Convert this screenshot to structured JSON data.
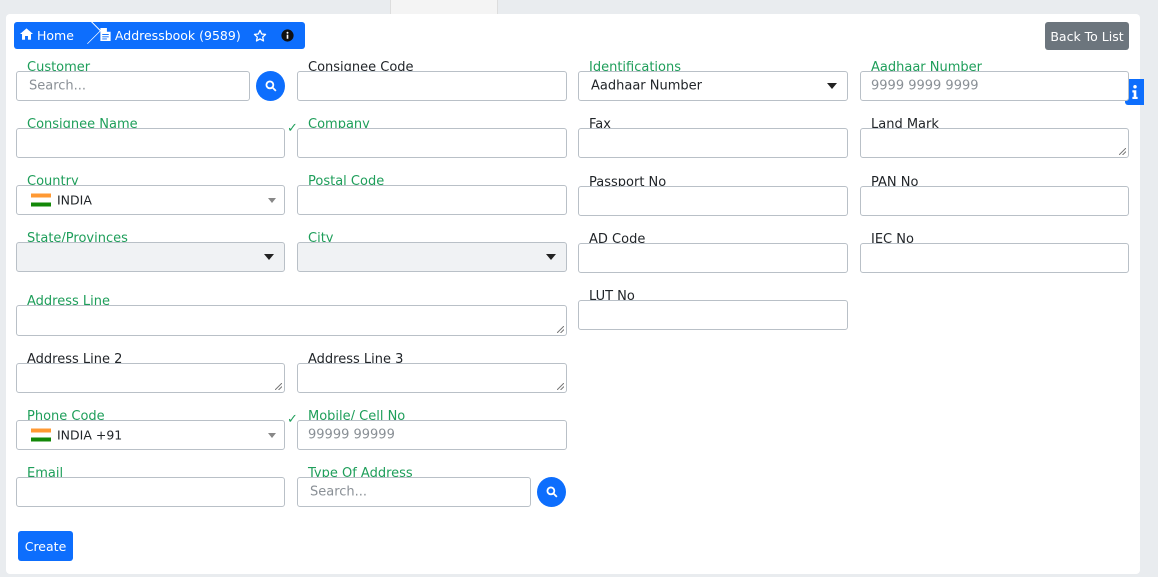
{
  "breadcrumb": {
    "home_label": "Home",
    "page_label": "Addressbook (9589)"
  },
  "header": {
    "back_label": "Back To List"
  },
  "form": {
    "customer": {
      "label": "Customer",
      "placeholder": "Search..."
    },
    "consignee_code": {
      "label": "Consignee Code"
    },
    "identifications": {
      "label": "Identifications",
      "value": "Aadhaar Number"
    },
    "aadhaar_number": {
      "label": "Aadhaar Number",
      "placeholder": "9999 9999 9999"
    },
    "consignee_name": {
      "label": "Consignee Name"
    },
    "company": {
      "label": "Company"
    },
    "fax": {
      "label": "Fax"
    },
    "land_mark": {
      "label": "Land Mark"
    },
    "country": {
      "label": "Country",
      "value": "INDIA"
    },
    "postal_code": {
      "label": "Postal Code"
    },
    "passport_no": {
      "label": "Passport No"
    },
    "pan_no": {
      "label": "PAN No"
    },
    "state": {
      "label": "State/Provinces"
    },
    "city": {
      "label": "City"
    },
    "ad_code": {
      "label": "AD Code"
    },
    "iec_no": {
      "label": "IEC No"
    },
    "address_line": {
      "label": "Address Line"
    },
    "lut_no": {
      "label": "LUT No"
    },
    "address_line_2": {
      "label": "Address Line 2"
    },
    "address_line_3": {
      "label": "Address Line 3"
    },
    "phone_code": {
      "label": "Phone Code",
      "value": "INDIA +91"
    },
    "mobile": {
      "label": "Mobile/ Cell No",
      "placeholder": "99999 99999"
    },
    "email": {
      "label": "Email"
    },
    "type_of_address": {
      "label": "Type Of Address",
      "placeholder": "Search..."
    }
  },
  "actions": {
    "create_label": "Create"
  },
  "colors": {
    "primary": "#0d6efd",
    "required_label": "#1e9e5a",
    "secondary_button": "#6c757d",
    "flag_saffron": "#FF9933",
    "flag_green": "#138808"
  },
  "icons": [
    "home-icon",
    "document-icon",
    "star-outline-icon",
    "info-circle-icon",
    "search-icon",
    "dropdown-caret-icon",
    "check-icon",
    "info-icon"
  ]
}
